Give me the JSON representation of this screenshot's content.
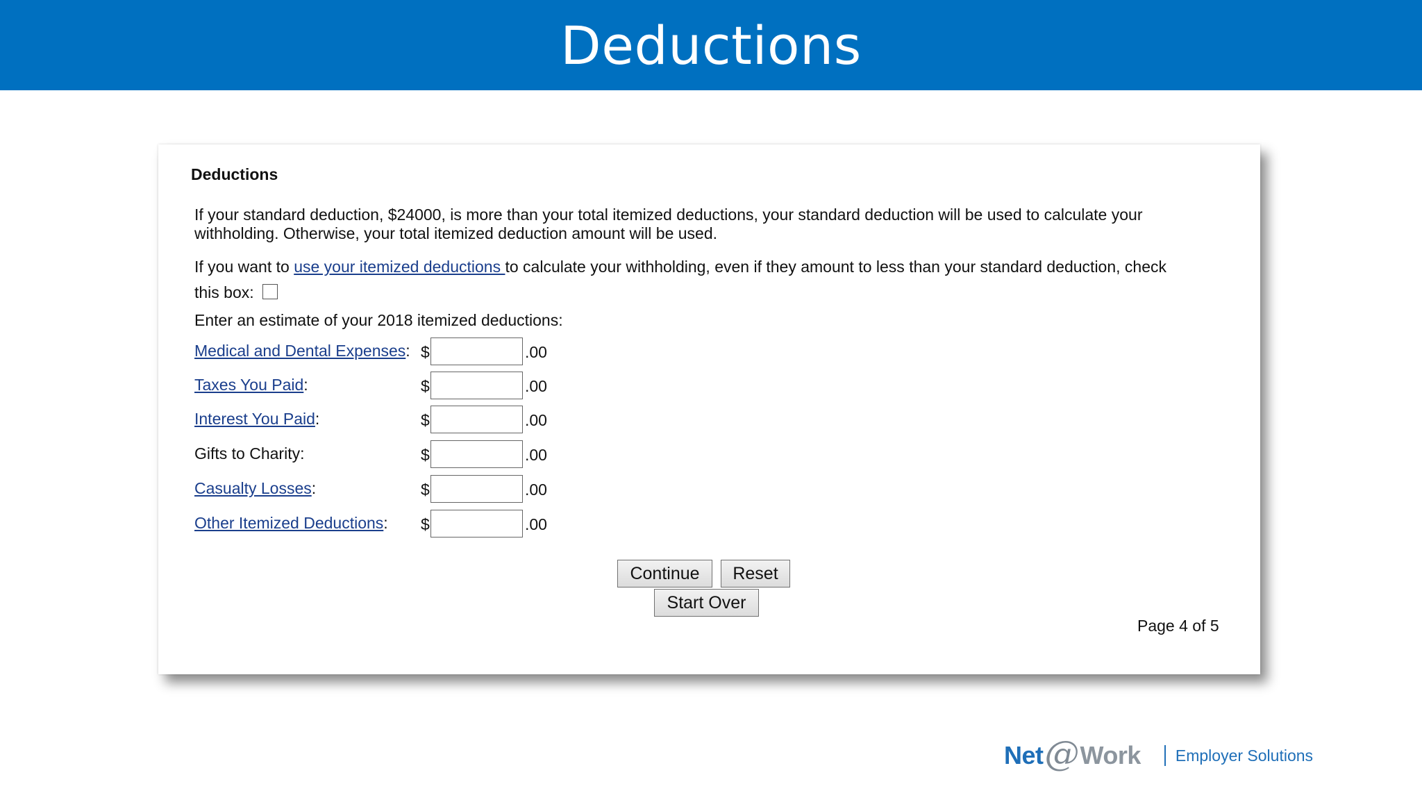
{
  "slide": {
    "title": "Deductions"
  },
  "form": {
    "heading": "Deductions",
    "intro": "If your standard deduction, $24000, is more than your total itemized deductions, your standard deduction will be used to calculate your withholding. Otherwise, your total itemized deduction amount will be used.",
    "itemized_prefix": "If you want to ",
    "itemized_link": "use your itemized deductions ",
    "itemized_suffix": "to calculate your withholding, even if they amount to less than your standard deduction, check this box:",
    "itemized_checked": false,
    "estimate_prompt": "Enter an estimate of your 2018 itemized deductions:",
    "currency_symbol": "$",
    "cents_suffix": ".00",
    "rows": [
      {
        "label": "Medical and Dental Expenses",
        "is_link": true,
        "value": ""
      },
      {
        "label": "Taxes You Paid",
        "is_link": true,
        "value": ""
      },
      {
        "label": "Interest You Paid",
        "is_link": true,
        "value": ""
      },
      {
        "label": "Gifts to Charity",
        "is_link": false,
        "value": ""
      },
      {
        "label": "Casualty Losses",
        "is_link": true,
        "value": ""
      },
      {
        "label": "Other Itemized Deductions",
        "is_link": true,
        "value": ""
      }
    ],
    "buttons": {
      "continue": "Continue",
      "reset": "Reset",
      "start_over": "Start Over"
    },
    "page_indicator": "Page 4 of 5"
  },
  "footer": {
    "logo_net": "Net",
    "logo_at": "@",
    "logo_work": "Work",
    "tagline": "Employer Solutions"
  },
  "colors": {
    "banner": "#0070c0",
    "link": "#1a3e8c",
    "brand_blue": "#1f6fb8",
    "brand_gray": "#8c959e"
  }
}
